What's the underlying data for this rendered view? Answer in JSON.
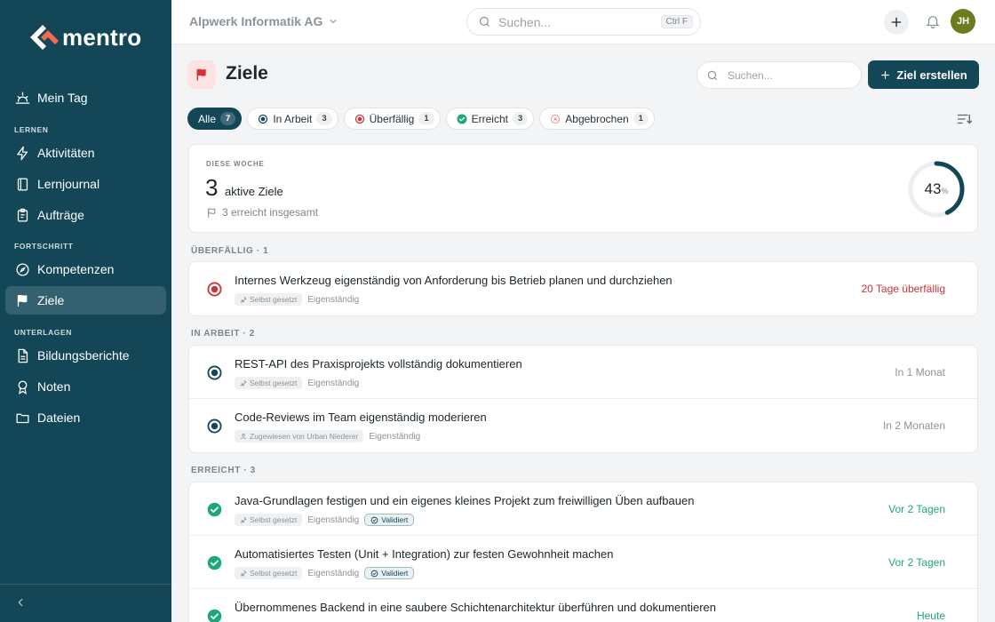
{
  "app": {
    "brand": "mentro"
  },
  "sidebar": {
    "sections": {
      "learn": "LERNEN",
      "progress": "FORTSCHRITT",
      "docs": "UNTERLAGEN"
    },
    "items": [
      {
        "label": "Mein Tag",
        "icon": "sunrise-icon"
      },
      {
        "label": "Aktivitäten",
        "icon": "lightning-icon"
      },
      {
        "label": "Lernjournal",
        "icon": "book-icon"
      },
      {
        "label": "Aufträge",
        "icon": "clipboard-icon"
      },
      {
        "label": "Kompetenzen",
        "icon": "compass-icon"
      },
      {
        "label": "Ziele",
        "icon": "flag-icon",
        "active": true
      },
      {
        "label": "Bildungsberichte",
        "icon": "document-icon"
      },
      {
        "label": "Noten",
        "icon": "award-icon"
      },
      {
        "label": "Dateien",
        "icon": "folder-icon"
      }
    ]
  },
  "topbar": {
    "org": "Alpwerk Informatik AG",
    "search_placeholder": "Suchen...",
    "shortcut": "Ctrl F",
    "avatar_initials": "JH"
  },
  "page": {
    "title": "Ziele",
    "search_placeholder": "Suchen...",
    "create_label": "Ziel erstellen"
  },
  "filters": [
    {
      "label": "Alle",
      "count": "7",
      "active": true
    },
    {
      "label": "In Arbeit",
      "count": "3",
      "icon": "in-progress-icon"
    },
    {
      "label": "Überfällig",
      "count": "1",
      "icon": "overdue-icon"
    },
    {
      "label": "Erreicht",
      "count": "3",
      "icon": "check-icon"
    },
    {
      "label": "Abgebrochen",
      "count": "1",
      "icon": "cancelled-icon"
    }
  ],
  "week": {
    "label": "DIESE WOCHE",
    "count": "3",
    "text": "aktive Ziele",
    "sub": "3 erreicht insgesamt",
    "percent": "43",
    "percent_unit": "%",
    "progress": 0.43
  },
  "groups": {
    "overdue": "ÜBERFÄLLIG · 1",
    "in_progress": "IN ARBEIT · 2",
    "achieved": "ERREICHT · 3"
  },
  "goals": {
    "overdue": [
      {
        "title": "Internes Werkzeug eigenständig von Anforderung bis Betrieb planen und durchziehen",
        "tag": "Selbst gesetzt",
        "type": "Eigenständig",
        "due": "20 Tage überfällig"
      }
    ],
    "in_progress": [
      {
        "title": "REST-API des Praxisprojekts vollständig dokumentieren",
        "tag": "Selbst gesetzt",
        "type": "Eigenständig",
        "due": "In 1 Monat"
      },
      {
        "title": "Code-Reviews im Team eigenständig moderieren",
        "tag": "Zugewiesen von Urban Niederer",
        "type": "Eigenständig",
        "due": "In 2 Monaten"
      }
    ],
    "achieved": [
      {
        "title": "Java-Grundlagen festigen und ein eigenes kleines Projekt zum freiwilligen Üben aufbauen",
        "tag": "Selbst gesetzt",
        "type": "Eigenständig",
        "badge": "Validiert",
        "due": "Vor 2 Tagen"
      },
      {
        "title": "Automatisiertes Testen (Unit + Integration) zur festen Gewohnheit machen",
        "tag": "Selbst gesetzt",
        "type": "Eigenständig",
        "badge": "Validiert",
        "due": "Vor 2 Tagen"
      },
      {
        "title": "Übernommenes Backend in eine saubere Schichtenarchitektur überführen und dokumentieren",
        "due": "Heute"
      }
    ]
  },
  "colors": {
    "sidebar": "#134758",
    "overdue": "#c9333a",
    "done": "#1ea77a",
    "progress_ring": "#134758"
  }
}
